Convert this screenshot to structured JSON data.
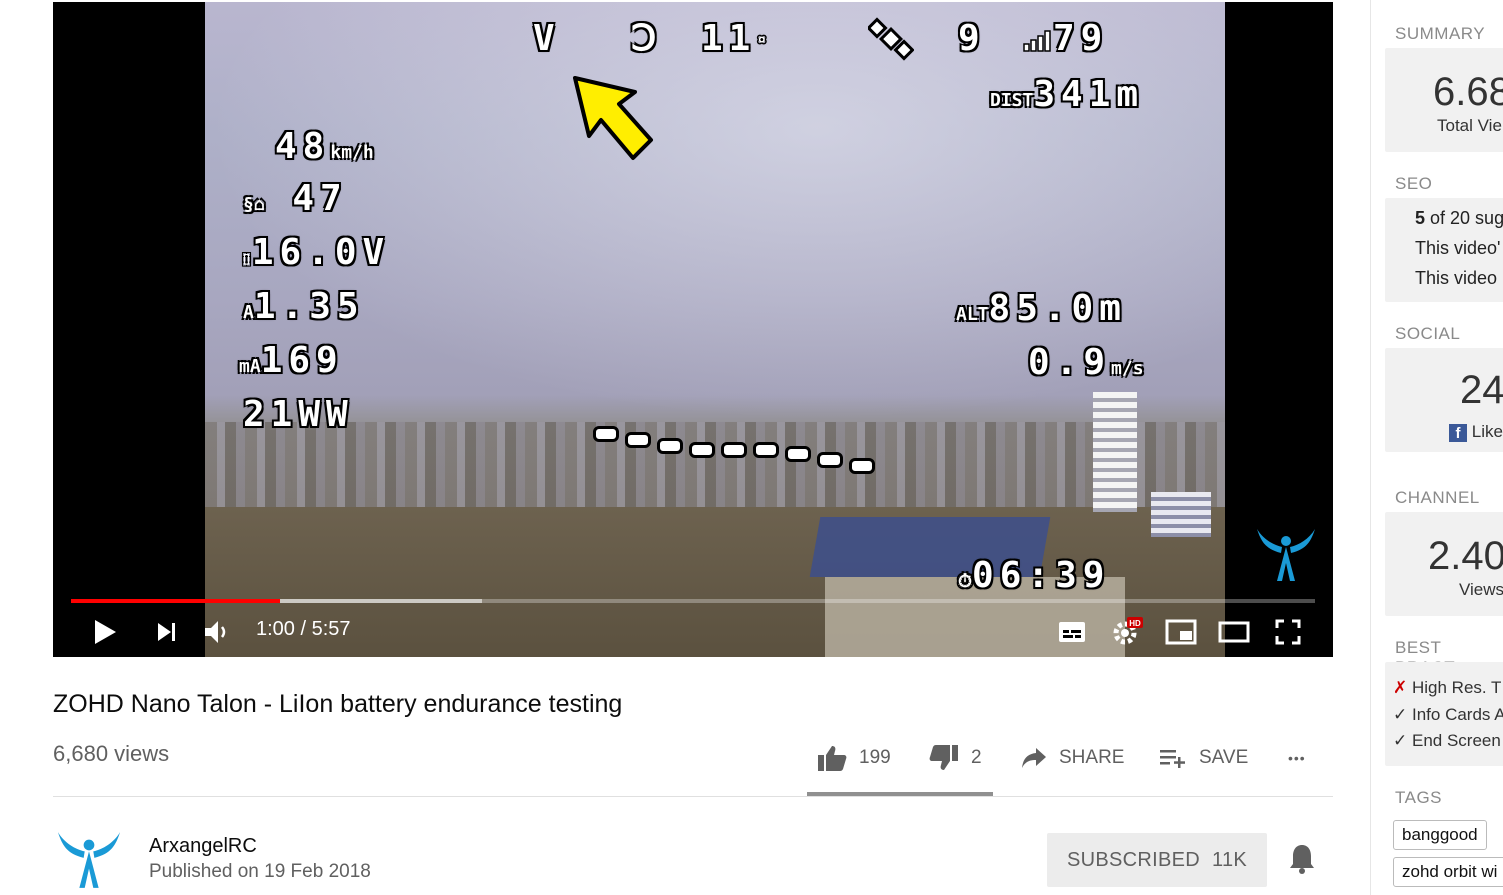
{
  "player": {
    "time_current": "1:00",
    "time_total": "5:57",
    "time_display": "1:00 / 5:57",
    "progress_fraction": 0.168,
    "buffer_fraction": 0.33,
    "hd_badge": "HD",
    "osd": {
      "sats_count": "11",
      "gps_sats": "9",
      "signal": "79",
      "dist_label": "DIST",
      "dist_value": "341m",
      "speed_value": "48",
      "speed_unit": "km/h",
      "heading_value": "47",
      "voltage": "16.0V",
      "current": "1.35",
      "mah": "169",
      "power": "21WW",
      "alt_label": "ALT",
      "alt_value": "85.0m",
      "vario": "0.9",
      "vario_unit": "m/s",
      "flight_time": "06:39"
    }
  },
  "video": {
    "title": "ZOHD Nano Talon - LiIon battery endurance testing",
    "views": "6,680 views"
  },
  "actions": {
    "likes": "199",
    "dislikes": "2",
    "share": "SHARE",
    "save": "SAVE",
    "more": "•••"
  },
  "channel": {
    "name": "ArxangelRC",
    "published": "Published on 19 Feb 2018",
    "subscribe_label": "SUBSCRIBED",
    "subscriber_count": "11K"
  },
  "sidebar": {
    "summary_head": "SUMMARY",
    "summary_value": "6.68",
    "summary_label": "Total Vie",
    "seo_head": "SEO",
    "seo_count_bold": "5",
    "seo_line1_rest": " of 20 sug",
    "seo_line2": "This video'",
    "seo_line3": "This video",
    "social_head": "SOCIAL",
    "social_value": "24",
    "social_label": "Like",
    "channel_head": "CHANNEL",
    "channel_value": "2.40",
    "channel_label": "Views",
    "bp_head": "BEST PRACT",
    "bp_items": [
      {
        "mark": "✗",
        "label": "High Res. T"
      },
      {
        "mark": "✓",
        "label": "Info Cards A"
      },
      {
        "mark": "✓",
        "label": "End Screen"
      }
    ],
    "tags_head": "TAGS",
    "tags": [
      "banggood",
      "zohd orbit wi"
    ]
  },
  "colors": {
    "progress_played": "#ff0000",
    "fail_mark": "#cc0000",
    "facebook": "#3b5998",
    "arrow_yellow": "#ffee00"
  }
}
